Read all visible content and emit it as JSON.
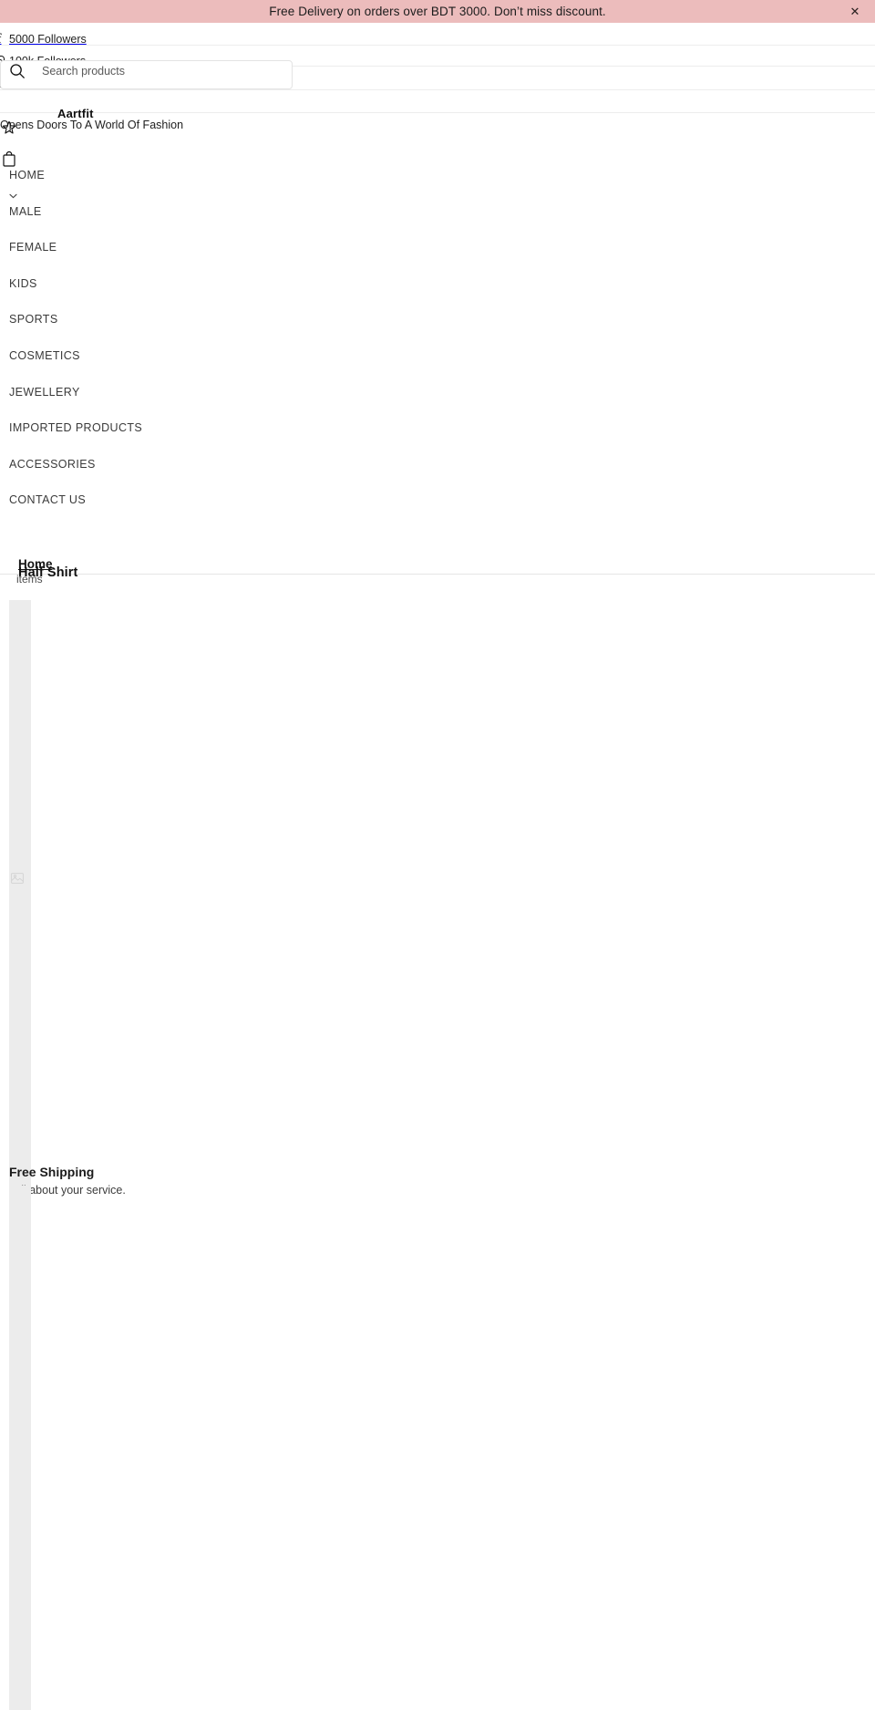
{
  "announcement": {
    "text": "Free Delivery on orders over BDT 3000. Don’t miss discount.",
    "close_label": "✕",
    "background": "#ecbcbc"
  },
  "header": {
    "social": [
      {
        "icon": "facebook-icon",
        "label": "5000 Followers"
      },
      {
        "icon": "instagram-icon",
        "label": "100k Followers"
      },
      {
        "icon": "tiktok-icon",
        "label": ""
      }
    ],
    "search": {
      "placeholder": "Search products",
      "value": "",
      "icon": "search-icon"
    },
    "brand": {
      "name": "Aartfit",
      "tagline": "Opens Doors To A World Of Fashion"
    },
    "icons": {
      "wishlist": "star-icon",
      "cart": "shopping-bag-icon"
    }
  },
  "nav": {
    "items": [
      {
        "label": "HOME",
        "has_dropdown": true
      },
      {
        "label": "MALE",
        "has_dropdown": false
      },
      {
        "label": "FEMALE",
        "has_dropdown": false
      },
      {
        "label": "KIDS",
        "has_dropdown": false
      },
      {
        "label": "SPORTS",
        "has_dropdown": false
      },
      {
        "label": "COSMETICS",
        "has_dropdown": false
      },
      {
        "label": "JEWELLERY",
        "has_dropdown": false
      },
      {
        "label": "IMPORTED PRODUCTS",
        "has_dropdown": false
      },
      {
        "label": "ACCESSORIES",
        "has_dropdown": false
      },
      {
        "label": "CONTACT US",
        "has_dropdown": false
      }
    ]
  },
  "collection": {
    "breadcrumb": "Home",
    "title": "Half Shirt",
    "count_label": "items"
  },
  "feature": {
    "title": "Free Shipping",
    "description": "Tell about your service."
  }
}
